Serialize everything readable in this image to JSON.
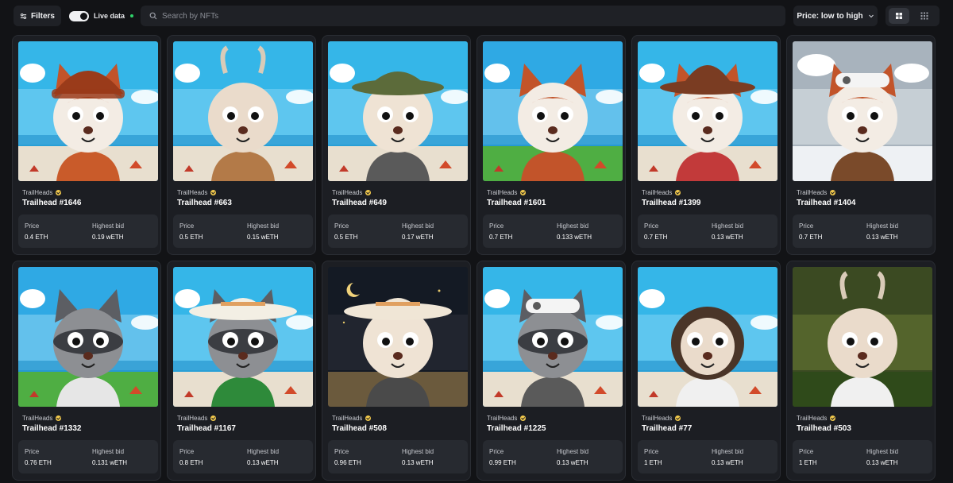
{
  "toolbar": {
    "filters_label": "Filters",
    "live_label": "Live data",
    "search_placeholder": "Search by NFTs",
    "sort_label": "Price: low to high",
    "view_modes": [
      "grid-large",
      "grid-small"
    ]
  },
  "labels": {
    "price": "Price",
    "highest_bid": "Highest bid"
  },
  "cards": [
    {
      "collection": "TrailHeads",
      "name": "Trailhead #1646",
      "price": "0.4 ETH",
      "highest_bid": "0.19 wETH",
      "art": {
        "animal": "fox",
        "bg": "beach",
        "hat": "beanie",
        "hat_color": "#9a3b1a",
        "fur": "#f3ece4",
        "accent": "#c95b2a"
      }
    },
    {
      "collection": "TrailHeads",
      "name": "Trailhead #663",
      "price": "0.5 ETH",
      "highest_bid": "0.15 wETH",
      "art": {
        "animal": "goat",
        "bg": "beach",
        "hat": "none",
        "hat_color": "#e2d6c8",
        "fur": "#eadbcb",
        "accent": "#b37a48"
      }
    },
    {
      "collection": "TrailHeads",
      "name": "Trailhead #649",
      "price": "0.5 ETH",
      "highest_bid": "0.17 wETH",
      "art": {
        "animal": "owl",
        "bg": "beach",
        "hat": "bucket",
        "hat_color": "#5c6b3a",
        "fur": "#efe3d4",
        "accent": "#5a5a5a"
      }
    },
    {
      "collection": "TrailHeads",
      "name": "Trailhead #1601",
      "price": "0.7 ETH",
      "highest_bid": "0.133 wETH",
      "art": {
        "animal": "fox",
        "bg": "meadow",
        "hat": "none",
        "hat_color": "#c2542a",
        "fur": "#f3ece4",
        "accent": "#c2542a"
      }
    },
    {
      "collection": "TrailHeads",
      "name": "Trailhead #1399",
      "price": "0.7 ETH",
      "highest_bid": "0.13 wETH",
      "art": {
        "animal": "fox",
        "bg": "beach",
        "hat": "straw",
        "hat_color": "#7a3c22",
        "fur": "#f3ece4",
        "accent": "#c23a3a"
      }
    },
    {
      "collection": "TrailHeads",
      "name": "Trailhead #1404",
      "price": "0.7 ETH",
      "highest_bid": "0.13 wETH",
      "art": {
        "animal": "fox",
        "bg": "snow",
        "hat": "visor",
        "hat_color": "#f4f4f4",
        "fur": "#f3ece4",
        "accent": "#7a4a2a"
      }
    },
    {
      "collection": "TrailHeads",
      "name": "Trailhead #1332",
      "price": "0.76 ETH",
      "highest_bid": "0.131 wETH",
      "art": {
        "animal": "raccoon",
        "bg": "meadow",
        "hat": "none",
        "hat_color": "#777777",
        "fur": "#8d8f93",
        "accent": "#e6e6e6"
      }
    },
    {
      "collection": "TrailHeads",
      "name": "Trailhead #1167",
      "price": "0.8 ETH",
      "highest_bid": "0.13 wETH",
      "art": {
        "animal": "raccoon",
        "bg": "beach",
        "hat": "sun",
        "hat_color": "#f3efe4",
        "fur": "#8d8f93",
        "accent": "#2e8a3a"
      }
    },
    {
      "collection": "TrailHeads",
      "name": "Trailhead #508",
      "price": "0.96 ETH",
      "highest_bid": "0.13 wETH",
      "art": {
        "animal": "owl",
        "bg": "night",
        "hat": "sun",
        "hat_color": "#f0e6d6",
        "fur": "#efe3d4",
        "accent": "#4a4a4a"
      }
    },
    {
      "collection": "TrailHeads",
      "name": "Trailhead #1225",
      "price": "0.99 ETH",
      "highest_bid": "0.13 wETH",
      "art": {
        "animal": "raccoon",
        "bg": "beach",
        "hat": "visor",
        "hat_color": "#f4f4f4",
        "fur": "#8d8f93",
        "accent": "#5a5a5a"
      }
    },
    {
      "collection": "TrailHeads",
      "name": "Trailhead #77",
      "price": "1 ETH",
      "highest_bid": "0.13 wETH",
      "art": {
        "animal": "bird",
        "bg": "beach",
        "hat": "none",
        "hat_color": "#7a4a2a",
        "fur": "#e9dccb",
        "accent": "#f0f0f0"
      }
    },
    {
      "collection": "TrailHeads",
      "name": "Trailhead #503",
      "price": "1 ETH",
      "highest_bid": "0.13 wETH",
      "art": {
        "animal": "goat",
        "bg": "forest",
        "hat": "none",
        "hat_color": "#e2d6c8",
        "fur": "#eadbcb",
        "accent": "#f0f0f0"
      }
    }
  ]
}
